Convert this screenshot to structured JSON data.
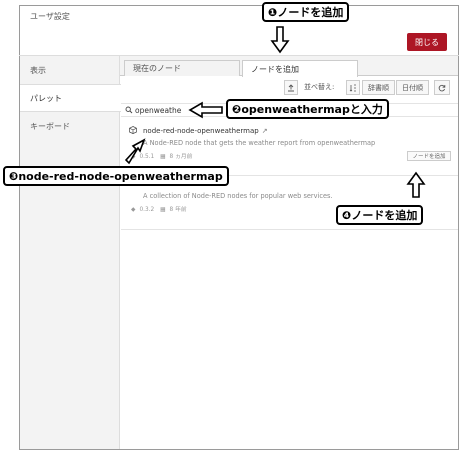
{
  "dialog": {
    "title": "ユーザ設定",
    "close_label": "閉じる"
  },
  "sidebar": {
    "items": [
      {
        "label": "表示"
      },
      {
        "label": "パレット"
      },
      {
        "label": "キーボード"
      }
    ]
  },
  "tabs": [
    {
      "label": "現在のノード"
    },
    {
      "label": "ノードを追加"
    }
  ],
  "toolbar": {
    "upload_icon": "upload-icon",
    "sort_label": "並べ替え:",
    "sort_icon": "sort-icon",
    "sort_dictionary": "辞書順",
    "sort_date": "日付順",
    "refresh_icon": "refresh-icon"
  },
  "search": {
    "value": "openweathe"
  },
  "results": [
    {
      "name": "node-red-node-openweathermap",
      "description": "A Node-RED node that gets the weather report from openweathermap",
      "version": "0.5.1",
      "updated": "8 ヵ月前",
      "install_label": "ノードを追加"
    },
    {
      "name": "",
      "description": "A collection of Node-RED nodes for popular web services.",
      "version": "0.3.2",
      "updated": "8 年前",
      "install_label": ""
    }
  ],
  "callouts": {
    "c1": {
      "num": "❶",
      "text": "ノードを追加"
    },
    "c2": {
      "num": "❷",
      "text": "openweathermapと入力"
    },
    "c3": {
      "num": "❸",
      "text": "node-red-node-openweathermap"
    },
    "c4": {
      "num": "❹",
      "text": "ノードを追加"
    }
  },
  "colors": {
    "primary": "#ad1625",
    "annotation": "#000000"
  }
}
